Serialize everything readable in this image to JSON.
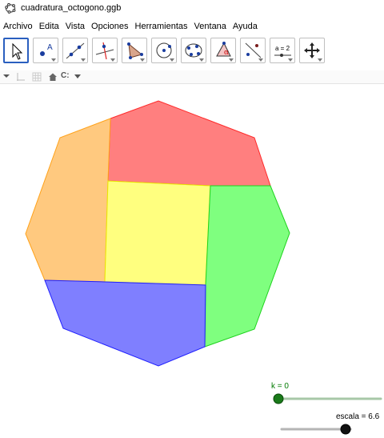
{
  "window": {
    "title": "cuadratura_octogono.ggb"
  },
  "menu": {
    "items": [
      {
        "label": "Archivo"
      },
      {
        "label": "Edita"
      },
      {
        "label": "Vista"
      },
      {
        "label": "Opciones"
      },
      {
        "label": "Herramientas"
      },
      {
        "label": "Ventana"
      },
      {
        "label": "Ayuda"
      }
    ]
  },
  "toolbar": {
    "tools": [
      {
        "icon": "move-arrow-icon",
        "active": true
      },
      {
        "icon": "point-icon"
      },
      {
        "icon": "line-through-two-points-icon"
      },
      {
        "icon": "perpendicular-line-icon"
      },
      {
        "icon": "polygon-icon"
      },
      {
        "icon": "circle-center-point-icon"
      },
      {
        "icon": "conic-through-points-icon"
      },
      {
        "icon": "angle-icon"
      },
      {
        "icon": "reflect-about-line-icon"
      },
      {
        "icon": "slider-icon",
        "text": "a = 2"
      },
      {
        "icon": "move-graphics-view-icon"
      }
    ]
  },
  "stylebar": {
    "items": [
      "toggle-stylebar-icon",
      "axes-icon",
      "grid-icon",
      "home-icon",
      "point-capture-icon"
    ],
    "capture_label": "C:"
  },
  "graphics": {
    "colors": {
      "red": "#ff7f7f",
      "orange": "#ffc97f",
      "yellow": "#ffff7f",
      "green": "#7fff7f",
      "blue": "#7f7fff",
      "red_edge": "#ff0000",
      "orange_edge": "#ff9d00",
      "yellow_edge": "#e0e000",
      "green_edge": "#00dd00",
      "blue_edge": "#0000ff"
    },
    "sliders": [
      {
        "label": "k = 0",
        "value": 0
      },
      {
        "label": "escala = 6.6",
        "value": 0.85
      }
    ]
  }
}
